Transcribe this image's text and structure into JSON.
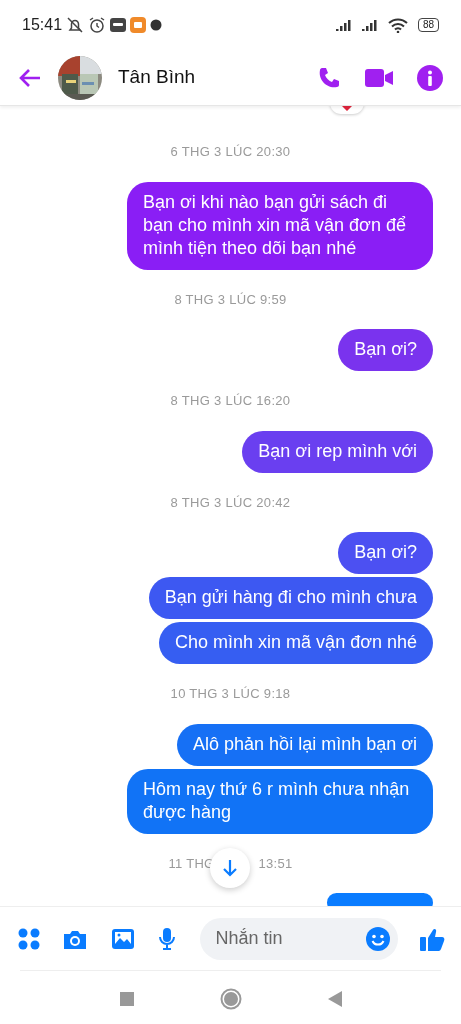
{
  "status_bar": {
    "time": "15:41",
    "battery": "88"
  },
  "header": {
    "contact_name": "Tân Bình"
  },
  "chat": [
    {
      "kind": "time",
      "text": "6 THG 3 LÚC 20:30"
    },
    {
      "kind": "message",
      "text": "Bạn ơi khi nào bạn gửi sách đi bạn cho mình xin mã vận đơn để mình tiện theo dõi bạn nhé",
      "color": "#8a1ef5"
    },
    {
      "kind": "time",
      "text": "8 THG 3 LÚC 9:59"
    },
    {
      "kind": "message",
      "text": "Bạn ơi?",
      "color": "#7a33ee"
    },
    {
      "kind": "time",
      "text": "8 THG 3 LÚC 16:20"
    },
    {
      "kind": "message",
      "text": "Bạn ơi rep mình với",
      "color": "#6a3ff0"
    },
    {
      "kind": "time",
      "text": "8 THG 3 LÚC 20:42"
    },
    {
      "kind": "message",
      "text": "Bạn ơi?",
      "color": "#4c50f2"
    },
    {
      "kind": "message",
      "text": "Bạn gửi hàng đi cho mình chưa",
      "color": "#3d58f2"
    },
    {
      "kind": "message",
      "text": "Cho mình xin mã vận đơn nhé",
      "color": "#365ef2"
    },
    {
      "kind": "time",
      "text": "10 THG 3 LÚC 9:18"
    },
    {
      "kind": "message",
      "text": "Alô phản hồi lại mình bạn ơi",
      "color": "#1670f5"
    },
    {
      "kind": "message",
      "text": "Hôm nay thứ 6 r mình chưa nhận được hàng",
      "color": "#1173f6"
    },
    {
      "kind": "split_time",
      "left": "11 THG",
      "right": "13:51"
    },
    {
      "kind": "message",
      "color": "#0a7cff"
    }
  ],
  "composer": {
    "placeholder": "Nhắn tin"
  }
}
